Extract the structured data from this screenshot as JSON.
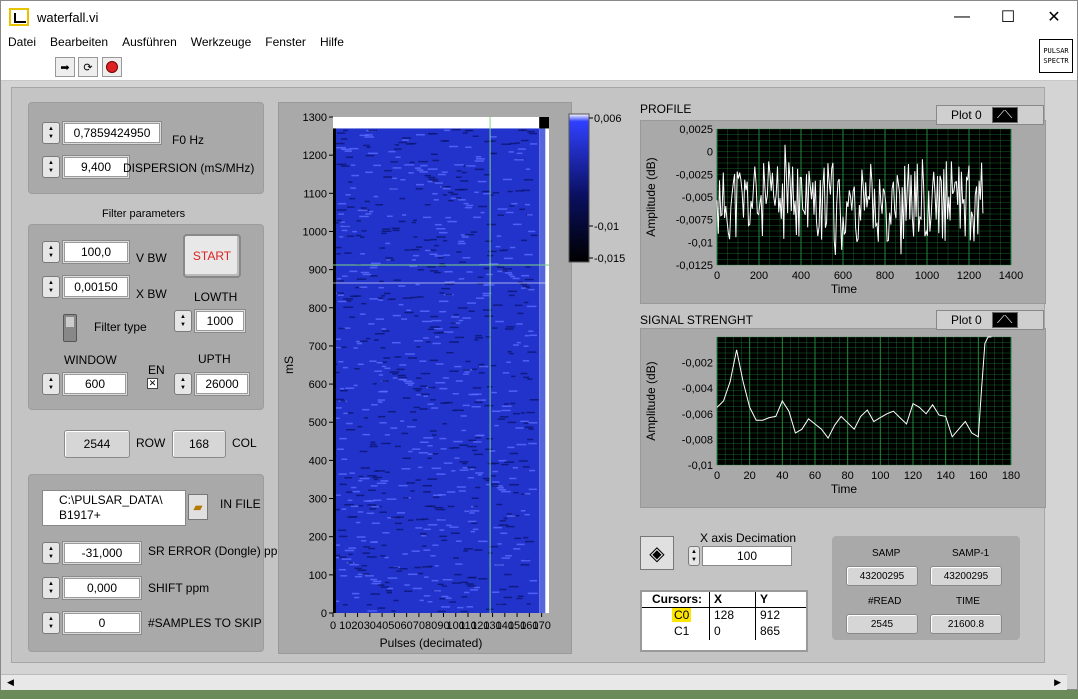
{
  "window": {
    "title": "waterfall.vi",
    "minimize": "—",
    "maximize": "☐",
    "close": "✕"
  },
  "menu": [
    "Datei",
    "Bearbeiten",
    "Ausführen",
    "Werkzeuge",
    "Fenster",
    "Hilfe"
  ],
  "vi_icon_text": [
    "PULSAR",
    "SPECTR"
  ],
  "controls": {
    "f0": {
      "value": "0,7859424950",
      "label": "F0 Hz"
    },
    "dispersion": {
      "value": "9,400",
      "label": "DISPERSION (mS/MHz)"
    },
    "filter_title": "Filter parameters",
    "vbw": {
      "value": "100,0",
      "label": "V BW"
    },
    "xbw": {
      "value": "0,00150",
      "label": "X BW"
    },
    "start_label": "START",
    "lowth": {
      "value": "1000",
      "label": "LOWTH"
    },
    "filter_type_label": "Filter type",
    "window": {
      "value": "600",
      "label": "WINDOW"
    },
    "en_label": "EN",
    "upth": {
      "value": "26000",
      "label": "UPTH"
    },
    "row": {
      "value": "2544",
      "label": "ROW"
    },
    "col": {
      "value": "168",
      "label": "COL"
    },
    "in_file": {
      "value_line1": "C:\\PULSAR_DATA\\",
      "value_line2": "B1917+",
      "label": "IN FILE"
    },
    "sr_error": {
      "value": "-31,000",
      "label": "SR ERROR (Dongle) ppm"
    },
    "shift": {
      "value": "0,000",
      "label": "SHIFT ppm"
    },
    "skip": {
      "value": "0",
      "label": "#SAMPLES TO SKIP"
    },
    "xdec": {
      "value": "100",
      "label": "X axis Decimation"
    }
  },
  "indicators": {
    "samp": {
      "label": "SAMP",
      "value": "43200295"
    },
    "samp1": {
      "label": "SAMP-1",
      "value": "43200295"
    },
    "read": {
      "label": "#READ",
      "value": "2545"
    },
    "time": {
      "label": "TIME",
      "value": "21600.8"
    }
  },
  "cursors": {
    "header": [
      "Cursors:",
      "X",
      "Y"
    ],
    "rows": [
      {
        "name": "C0",
        "x": "128",
        "y": "912"
      },
      {
        "name": "C1",
        "x": "0",
        "y": "865"
      }
    ]
  },
  "colors": {
    "plot_bg": "#000000",
    "grid": "#1f8a3a",
    "trace": "#ffffff",
    "waterfall": "#2233cc",
    "cursor": "#7fd67f",
    "start_text": "#dd2222"
  },
  "chart_data": [
    {
      "type": "heatmap",
      "xlabel": "Pulses (decimated)",
      "ylabel": "mS",
      "x_ticks": [
        "0",
        "10",
        "20",
        "30",
        "40",
        "50",
        "60",
        "70",
        "80",
        "90",
        "100",
        "110",
        "120",
        "130",
        "140",
        "150",
        "160",
        "170"
      ],
      "y_ticks": [
        "0",
        "100",
        "200",
        "300",
        "400",
        "500",
        "600",
        "700",
        "800",
        "900",
        "1000",
        "1100",
        "1200",
        "1300"
      ],
      "xlim": [
        0,
        176
      ],
      "ylim": [
        0,
        1300
      ],
      "colorbar_ticks": [
        "0,006",
        "-0,01",
        "-0,015"
      ],
      "cursor_x": 128,
      "cursor_y1": 912,
      "cursor_y2": 865
    },
    {
      "type": "line",
      "title": "PROFILE",
      "legend": "Plot 0",
      "xlabel": "Time",
      "ylabel": "Amplitude (dB)",
      "xlim": [
        0,
        1400
      ],
      "ylim": [
        -0.0125,
        0.0025
      ],
      "x_ticks": [
        "0",
        "200",
        "400",
        "600",
        "800",
        "1000",
        "1200",
        "1400"
      ],
      "y_ticks": [
        "0,0025",
        "0",
        "-0,0025",
        "-0,005",
        "-0,0075",
        "-0,01",
        "-0,0125"
      ],
      "x_end": 1270
    },
    {
      "type": "line",
      "title": "SIGNAL STRENGHT",
      "legend": "Plot 0",
      "xlabel": "Time",
      "ylabel": "Amplitude (dB)",
      "xlim": [
        0,
        180
      ],
      "ylim": [
        -0.01,
        0
      ],
      "x_ticks": [
        "0",
        "20",
        "40",
        "60",
        "80",
        "100",
        "120",
        "140",
        "160",
        "180"
      ],
      "y_ticks": [
        "-0,002",
        "-0,004",
        "-0,006",
        "-0,008",
        "-0,01"
      ],
      "x": [
        0,
        4,
        8,
        12,
        16,
        20,
        24,
        28,
        32,
        36,
        40,
        44,
        48,
        52,
        56,
        60,
        64,
        68,
        72,
        76,
        80,
        84,
        88,
        92,
        96,
        100,
        104,
        108,
        112,
        116,
        120,
        124,
        128,
        132,
        136,
        140,
        144,
        148,
        152,
        156,
        160,
        162,
        164,
        166,
        168
      ],
      "y": [
        -0.0055,
        -0.005,
        -0.0035,
        -0.001,
        -0.0035,
        -0.0055,
        -0.0065,
        -0.0065,
        -0.0063,
        -0.0062,
        -0.005,
        -0.0058,
        -0.0075,
        -0.0072,
        -0.0064,
        -0.0068,
        -0.0072,
        -0.0079,
        -0.0069,
        -0.0062,
        -0.0067,
        -0.0072,
        -0.0062,
        -0.0057,
        -0.0066,
        -0.0063,
        -0.006,
        -0.0058,
        -0.0063,
        -0.0068,
        -0.0052,
        -0.0055,
        -0.006,
        -0.0053,
        -0.0061,
        -0.0062,
        -0.0078,
        -0.0072,
        -0.0066,
        -0.0075,
        -0.0078,
        -0.004,
        -0.0005,
        0,
        0
      ]
    }
  ]
}
